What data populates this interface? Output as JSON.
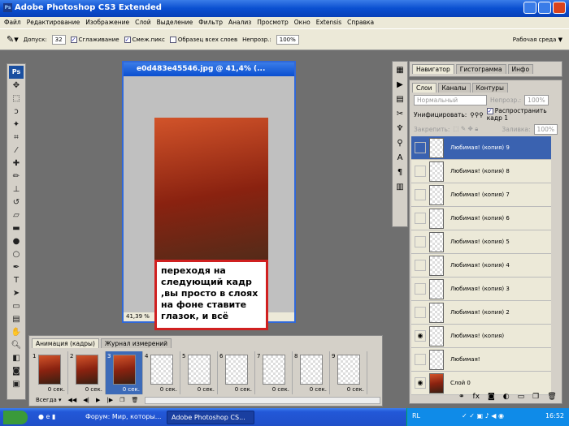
{
  "app": {
    "title": "Adobe Photoshop CS3 Extended",
    "logo": "Ps"
  },
  "menu": [
    "Файл",
    "Редактирование",
    "Изображение",
    "Слой",
    "Выделение",
    "Фильтр",
    "Анализ",
    "Просмотр",
    "Окно",
    "Extensis",
    "Справка"
  ],
  "options": {
    "tolerance_label": "Допуск:",
    "tolerance": "32",
    "antialias": "Сглаживание",
    "contiguous": "Смеж.пикс",
    "all_layers": "Образец всех слоев",
    "opacity_label": "Непрозр.:",
    "opacity": "100%",
    "workspace": "Рабочая среда ▼"
  },
  "document": {
    "title": "e0d483e45546.jpg @ 41,4% (...",
    "zoom": "41,39 %"
  },
  "callout": "переходя на следующий кадр ,вы просто в слоях на фоне ставите глазок, и всё",
  "animation": {
    "tabs": [
      "Анимация (кадры)",
      "Журнал измерений"
    ],
    "frames": [
      {
        "n": "1",
        "d": "0 сек.",
        "photo": true
      },
      {
        "n": "2",
        "d": "0 сек.",
        "photo": true
      },
      {
        "n": "3",
        "d": "0 сек.",
        "photo": true,
        "selected": true
      },
      {
        "n": "4",
        "d": "0 сек."
      },
      {
        "n": "5",
        "d": "0 сек."
      },
      {
        "n": "6",
        "d": "0 сек."
      },
      {
        "n": "7",
        "d": "0 сек."
      },
      {
        "n": "8",
        "d": "0 сек."
      },
      {
        "n": "9",
        "d": "0 сек."
      }
    ],
    "loop": "Всегда ▾"
  },
  "navigator": {
    "tabs": [
      "Навигатор",
      "Гистограмма",
      "Инфо"
    ]
  },
  "layers_panel": {
    "tabs": [
      "Слои",
      "Каналы",
      "Контуры"
    ],
    "blend": "Нормальный",
    "opacity_label": "Непрозр.:",
    "opacity": "100%",
    "unify": "Унифицировать:",
    "propagate": "Распространить кадр 1",
    "lock": "Закрепить:",
    "fill_label": "Заливка:",
    "fill": "100%",
    "layers": [
      {
        "name": "Любимая! (копия) 9",
        "selected": true
      },
      {
        "name": "Любимая! (копия) 8"
      },
      {
        "name": "Любимая! (копия) 7"
      },
      {
        "name": "Любимая! (копия) 6"
      },
      {
        "name": "Любимая! (копия) 5"
      },
      {
        "name": "Любимая! (копия) 4"
      },
      {
        "name": "Любимая! (копия) 3"
      },
      {
        "name": "Любимая! (копия) 2"
      },
      {
        "name": "Любимая! (копия)",
        "visible": true
      },
      {
        "name": "Любимая!"
      },
      {
        "name": "Слой 0",
        "visible": true,
        "photo": true
      }
    ]
  },
  "taskbar": {
    "items": [
      "Форум: Мир, которы...",
      "Adobe Photoshop CS..."
    ],
    "lang": "RL",
    "clock": "16:52"
  }
}
